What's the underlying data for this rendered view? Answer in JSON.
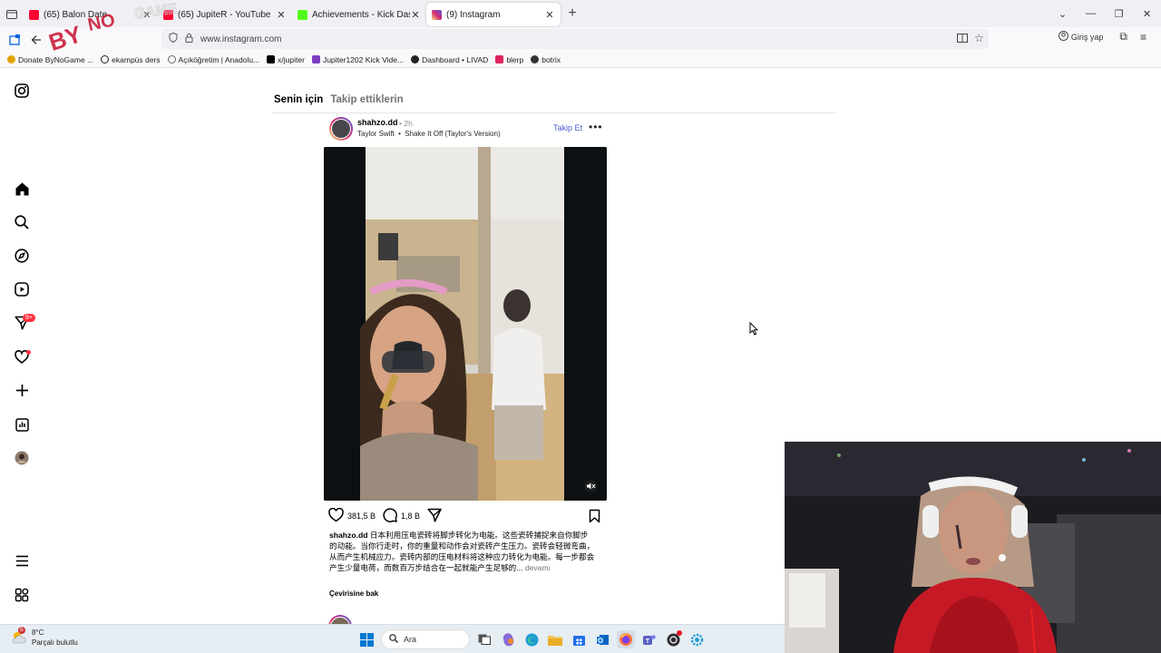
{
  "browser": {
    "tabs": [
      {
        "title": "(65) Balon Date",
        "close": "✕",
        "icon": "youtube-icon",
        "color": "#ff0033",
        "active": false
      },
      {
        "title": "(65) JupiteR - YouTube",
        "close": "✕",
        "icon": "youtube-icon",
        "color": "#ff0033",
        "active": false
      },
      {
        "title": "Achievements - Kick Dashboard",
        "close": "✕",
        "icon": "kick-icon",
        "color": "#53fc18",
        "active": false
      },
      {
        "title": "(9) Instagram",
        "close": "✕",
        "icon": "instagram-icon",
        "color": "#d62976",
        "active": true
      }
    ],
    "url": "www.instagram.com",
    "signin_label": "Giriş yap",
    "bookmarks": [
      {
        "label": "Donate ByNoGame ...",
        "color": "#e0a300"
      },
      {
        "label": "ekampüs ders",
        "color": "#222222"
      },
      {
        "label": "Açıköğretim | Anadolu...",
        "color": "#666666"
      },
      {
        "label": "x/jupiter",
        "color": "#000000"
      },
      {
        "label": "Jupiter1202 Kick Vide...",
        "color": "#7b3fc4"
      },
      {
        "label": "Dashboard • LIVAD",
        "color": "#222222"
      },
      {
        "label": "blerp",
        "color": "#e0245e"
      },
      {
        "label": "botrix",
        "color": "#333333"
      }
    ]
  },
  "overlay": {
    "logo_text": "ByNoGame"
  },
  "instagram": {
    "sidebar": {
      "icons": [
        "instagram-logo-icon",
        "home-icon",
        "search-icon",
        "explore-icon",
        "reels-icon",
        "messages-icon",
        "notifications-icon",
        "create-icon",
        "dashboard-icon",
        "profile-avatar",
        "menu-icon",
        "threads-icon"
      ],
      "messages_badge": "9+"
    },
    "feed_tabs": {
      "for_you": "Senin için",
      "following": "Takip ettiklerin"
    },
    "post": {
      "username": "shahzo.dd",
      "time": "• 2h",
      "music_artist": "Taylor Swift",
      "music_sep": "•",
      "music_song": "Shake It Off (Taylor's Version)",
      "follow_label": "Takip Et",
      "more_label": "•••",
      "likes": "381,5 B",
      "comments": "1,8 B",
      "caption_user": "shahzo.dd",
      "caption_text": "日本利用压电瓷砖将脚步转化为电能。这些瓷砖捕捉来自你脚步的动能。当你行走时，你的重量和动作会对瓷砖产生压力。瓷砖会轻微弯曲，从而产生机械应力。瓷砖内部的压电材料将这种应力转化为电能。每一步都会产生少量电荷，而数百万步结合在一起就能产生足够的...",
      "more_text": "devamı",
      "translate_label": "Çevirisine bak"
    }
  },
  "taskbar": {
    "temperature": "8°C",
    "weather_desc": "Parçalı bulutlu",
    "weather_badge": "5",
    "search_placeholder": "Ara"
  }
}
